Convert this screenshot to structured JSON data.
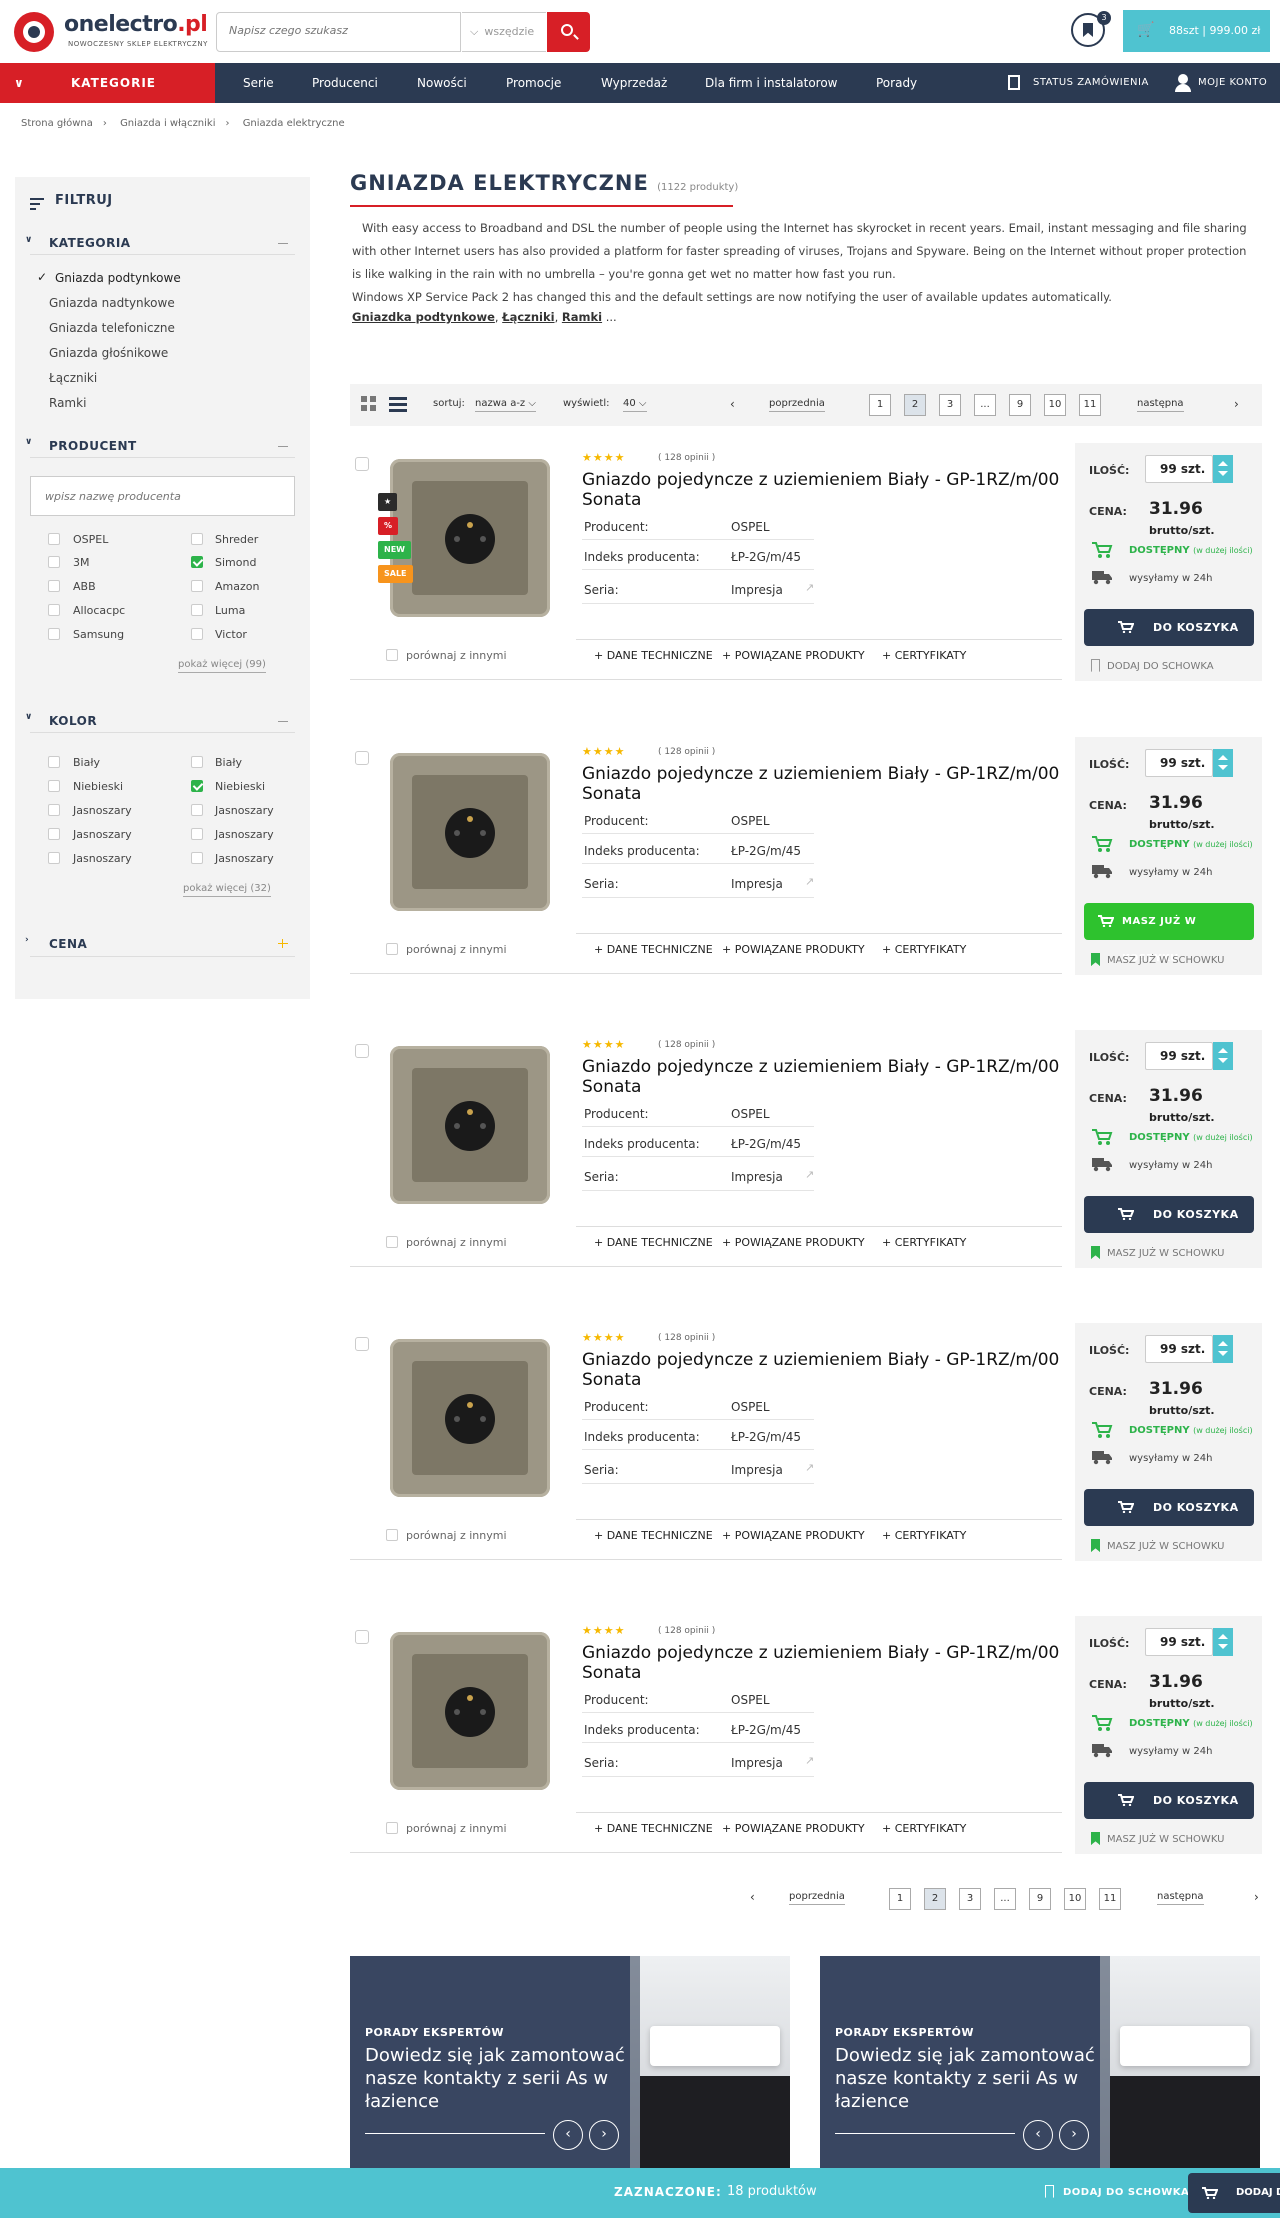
{
  "header": {
    "logo_name": "onelectro.pl",
    "logo_main": "onelectro",
    "logo_tld": ".pl",
    "logo_sub": "NOWOCZESNY SKLEP ELEKTRYCZNY",
    "search_placeholder": "Napisz czego szukasz",
    "search_scope": "wszędzie",
    "wishlist_count": "3",
    "cart_summary": "88szt | 999.00 zł"
  },
  "nav": {
    "categories_label": "KATEGORIE",
    "items": [
      "Serie",
      "Producenci",
      "Nowości",
      "Promocje",
      "Wyprzedaż",
      "Dla firm i instalatorow",
      "Porady"
    ],
    "order_status": "STATUS ZAMÓWIENIA",
    "account": "MOJE KONTO"
  },
  "breadcrumb": [
    "Strona główna",
    "Gniazda i włączniki",
    "Gniazda elektryczne"
  ],
  "sidebar": {
    "filter_title": "FILTRUJ",
    "category_title": "KATEGORIA",
    "categories": [
      "Gniazda podtynkowe",
      "Gniazda nadtynkowe",
      "Gniazda telefoniczne",
      "Gniazda głośnikowe",
      "Łączniki",
      "Ramki"
    ],
    "producer_title": "PRODUCENT",
    "producer_placeholder": "wpisz nazwę producenta",
    "producers_left": [
      "OSPEL",
      "3M",
      "ABB",
      "Allocacpc",
      "Samsung"
    ],
    "producers_right": [
      "Shreder",
      "Simond",
      "Amazon",
      "Luma",
      "Victor"
    ],
    "producers_more": "pokaż więcej (99)",
    "color_title": "KOLOR",
    "colors_left": [
      "Biały",
      "Niebieski",
      "Jasnoszary",
      "Jasnoszary",
      "Jasnoszary"
    ],
    "colors_right": [
      "Biały",
      "Niebieski",
      "Jasnoszary",
      "Jasnoszary",
      "Jasnoszary"
    ],
    "colors_more": "pokaż więcej (32)",
    "price_title": "CENA"
  },
  "main": {
    "title": "GNIAZDA ELEKTRYCZNE",
    "count": "(1122 produkty)",
    "desc1": "With easy access to Broadband and DSL the number of people using the Internet has skyrocket in recent years. Email, instant messaging and file sharing with other Internet users has also provided a platform for faster spreading of viruses, Trojans and Spyware. Being on the Internet without proper protection is like walking in the rain with no umbrella – you're gonna get wet no matter how fast you run.",
    "desc2": "Windows XP Service Pack 2 has changed this and the default settings are now notifying the user of available updates automatically.",
    "tags": [
      "Gniazdka podtynkowe",
      "Łączniki",
      "Ramki"
    ],
    "tags_sep": ",",
    "tags_more": "...",
    "sort_label": "sortuj:",
    "sort_value": "nazwa a-z",
    "show_label": "wyświetl:",
    "show_value": "40",
    "prev": "poprzednia",
    "next": "następna",
    "pages": [
      "1",
      "2",
      "3",
      "...",
      "9",
      "10",
      "11"
    ]
  },
  "product": {
    "stars": "★★★★",
    "reviews": "( 128 opinii )",
    "title": "Gniazdo pojedyncze z uziemieniem Biały - GP-1RZ/m/00 Sonata",
    "producer_label": "Producent:",
    "producer": "OSPEL",
    "index_label": "Indeks producenta:",
    "index": "ŁP-2G/m/45",
    "series_label": "Seria:",
    "series": "Impresja",
    "compare": "porównaj z innymi",
    "link_tech": "+ DANE TECHNICZNE",
    "link_related": "+ POWIĄZANE PRODUKTY",
    "link_cert": "+ CERTYFIKATY",
    "qty_label": "ILOŚĆ:",
    "qty": "99 szt.",
    "price_label": "CENA:",
    "price": "31.96",
    "price_unit": "brutto/szt.",
    "available": "DOSTĘPNY",
    "available_note": "(w dużej ilości)",
    "shipping": "wysyłamy w 24h",
    "add": "DO KOSZYKA",
    "in_cart": "MASZ JUŻ W KOSZYKU",
    "wish_add": "DODAJ DO SCHOWKA",
    "wish_in": "MASZ JUŻ W SCHOWKU",
    "badges": [
      {
        "label": "★",
        "color": "#2b2b2b"
      },
      {
        "label": "%",
        "color": "#d71f26"
      },
      {
        "label": "NEW",
        "color": "#2db34a"
      },
      {
        "label": "SALE",
        "color": "#f7941d"
      }
    ]
  },
  "promo": {
    "kicker": "PORADY EKSPERTÓW",
    "text": "Dowiedz się jak zamontować nasze kontakty z serii As w łazience"
  },
  "bottom_bar": {
    "selected_label": "ZAZNACZONE:",
    "selected_value": "18 produktów",
    "wishlist": "DODAJ DO SCHOWKA",
    "cart": "DODAJ DO KOSZYKA"
  },
  "colors": {
    "navy": "#2b3a52",
    "red": "#d71f26",
    "teal": "#4fc3d0",
    "green": "#2db34a"
  }
}
